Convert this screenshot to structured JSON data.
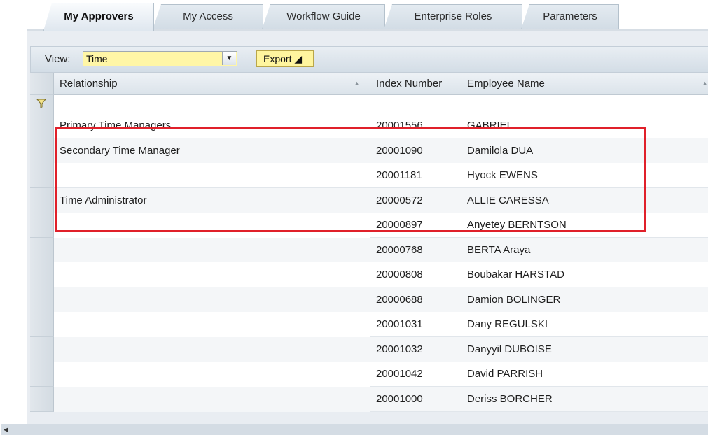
{
  "tabs": [
    {
      "label": "My Approvers",
      "active": true
    },
    {
      "label": "My Access",
      "active": false
    },
    {
      "label": "Workflow Guide",
      "active": false
    },
    {
      "label": "Enterprise Roles",
      "active": false
    },
    {
      "label": "Parameters",
      "active": false
    }
  ],
  "toolbar": {
    "view_label": "View:",
    "view_value": "Time",
    "dropdown_icon": "chevron-down-icon",
    "export_label": "Export ◢"
  },
  "table": {
    "columns": [
      "Relationship",
      "Index Number",
      "Employee Name"
    ],
    "rows": [
      {
        "relationship": "Primary Time Managers",
        "index": "20001556",
        "name": "GABRIEL"
      },
      {
        "relationship": "Secondary Time Manager",
        "index": "20001090",
        "name": "Damilola DUA"
      },
      {
        "relationship": "",
        "index": "20001181",
        "name": "Hyock EWENS"
      },
      {
        "relationship": "Time Administrator",
        "index": "20000572",
        "name": "ALLIE CARESSA"
      },
      {
        "relationship": "",
        "index": "20000897",
        "name": "Anyetey BERNTSON"
      },
      {
        "relationship": "",
        "index": "20000768",
        "name": "BERTA Araya"
      },
      {
        "relationship": "",
        "index": "20000808",
        "name": "Boubakar HARSTAD"
      },
      {
        "relationship": "",
        "index": "20000688",
        "name": "Damion BOLINGER"
      },
      {
        "relationship": "",
        "index": "20001031",
        "name": "Dany REGULSKI"
      },
      {
        "relationship": "",
        "index": "20001032",
        "name": "Danyyil DUBOISE"
      },
      {
        "relationship": "",
        "index": "20001042",
        "name": "David PARRISH"
      },
      {
        "relationship": "",
        "index": "20001000",
        "name": "Deriss BORCHER"
      }
    ]
  },
  "colors": {
    "highlight_box": "#e0202a",
    "view_select_bg": "#fff6a6",
    "export_bg": "#fff59e"
  }
}
